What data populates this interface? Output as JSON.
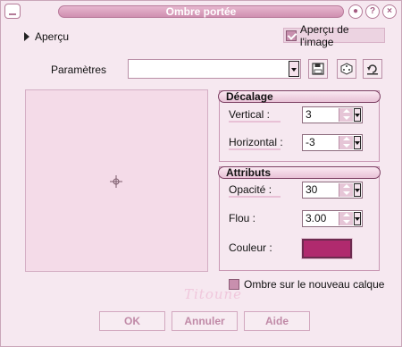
{
  "window": {
    "title": "Ombre portée"
  },
  "preview": {
    "toggle_label": "Aperçu",
    "image_preview_label": "Aperçu de l'image",
    "image_preview_checked": true
  },
  "parameters": {
    "label": "Paramètres",
    "selected_value": ""
  },
  "offset": {
    "header": "Décalage",
    "vertical_label": "Vertical :",
    "vertical_value": "3",
    "horizontal_label": "Horizontal :",
    "horizontal_value": "-3"
  },
  "attributes": {
    "header": "Attributs",
    "opacity_label": "Opacité :",
    "opacity_value": "30",
    "blur_label": "Flou :",
    "blur_value": "3.00",
    "color_label": "Couleur :",
    "color_value": "#b02a6e"
  },
  "new_layer": {
    "label": "Ombre sur le nouveau calque",
    "checked": false
  },
  "watermark_text": "Titoune",
  "buttons": {
    "ok": "OK",
    "cancel": "Annuler",
    "help": "Aide"
  },
  "icons": {
    "save": "save-icon",
    "random": "dice-icon",
    "reset": "reset-icon",
    "preview_crosshair": "crosshair-icon"
  },
  "colors": {
    "accent": "#c88fae",
    "header_border": "#7b3f62",
    "shadow_color": "#b02a6e"
  }
}
